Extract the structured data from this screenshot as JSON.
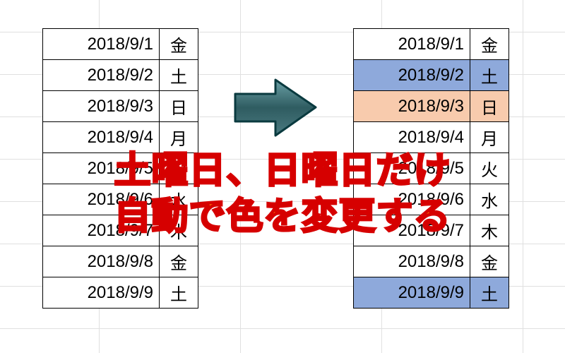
{
  "overlay": {
    "line1": "土曜日、日曜日だけ",
    "line2": "自動で色を変更する"
  },
  "left_table": {
    "rows": [
      {
        "date": "2018/9/1",
        "day": "金"
      },
      {
        "date": "2018/9/2",
        "day": "土"
      },
      {
        "date": "2018/9/3",
        "day": "日"
      },
      {
        "date": "2018/9/4",
        "day": "月"
      },
      {
        "date": "2018/9/5",
        "day": "火"
      },
      {
        "date": "2018/9/6",
        "day": "水"
      },
      {
        "date": "2018/9/7",
        "day": "木"
      },
      {
        "date": "2018/9/8",
        "day": "金"
      },
      {
        "date": "2018/9/9",
        "day": "土"
      }
    ]
  },
  "right_table": {
    "rows": [
      {
        "date": "2018/9/1",
        "day": "金",
        "highlight": ""
      },
      {
        "date": "2018/9/2",
        "day": "土",
        "highlight": "blue"
      },
      {
        "date": "2018/9/3",
        "day": "日",
        "highlight": "orange"
      },
      {
        "date": "2018/9/4",
        "day": "月",
        "highlight": ""
      },
      {
        "date": "2018/9/5",
        "day": "火",
        "highlight": ""
      },
      {
        "date": "2018/9/6",
        "day": "水",
        "highlight": ""
      },
      {
        "date": "2018/9/7",
        "day": "木",
        "highlight": ""
      },
      {
        "date": "2018/9/8",
        "day": "金",
        "highlight": ""
      },
      {
        "date": "2018/9/9",
        "day": "土",
        "highlight": "blue"
      }
    ]
  },
  "colors": {
    "saturday": "#8ea9db",
    "sunday": "#f8cbad",
    "arrow_fill": "#3a6a6f",
    "arrow_stroke": "#0a3a3f",
    "overlay_fill": "#ff7a00",
    "overlay_stroke": "#d60000"
  },
  "chart_data": {
    "type": "table",
    "description": "Excel date list, 9 rows, date column and weekday column; right table shows conditional formatting where Saturday rows are blue and Sunday rows are orange.",
    "columns": [
      "date",
      "weekday"
    ],
    "data": [
      [
        "2018/9/1",
        "金"
      ],
      [
        "2018/9/2",
        "土"
      ],
      [
        "2018/9/3",
        "日"
      ],
      [
        "2018/9/4",
        "月"
      ],
      [
        "2018/9/5",
        "火"
      ],
      [
        "2018/9/6",
        "水"
      ],
      [
        "2018/9/7",
        "木"
      ],
      [
        "2018/9/8",
        "金"
      ],
      [
        "2018/9/9",
        "土"
      ]
    ],
    "highlight_rules": [
      {
        "weekday": "土",
        "color": "#8ea9db"
      },
      {
        "weekday": "日",
        "color": "#f8cbad"
      }
    ]
  }
}
